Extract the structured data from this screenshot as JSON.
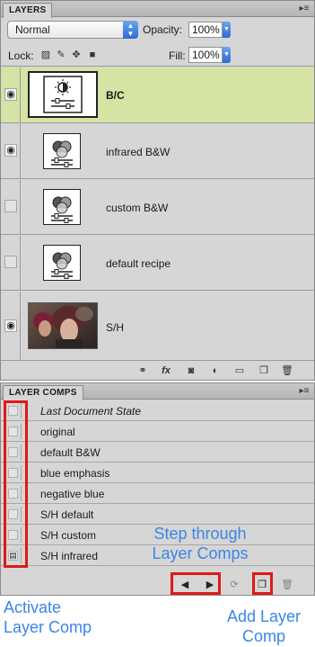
{
  "layers_panel": {
    "tab": "LAYERS",
    "menu_icon": "panel-menu-icon",
    "blend_mode": "Normal",
    "opacity_label": "Opacity:",
    "opacity_value": "100%",
    "lock_label": "Lock:",
    "fill_label": "Fill:",
    "fill_value": "100%",
    "layers": [
      {
        "name": "B/C",
        "visible": true,
        "selected": true,
        "thumb": "brightness-contrast-adjustment-icon"
      },
      {
        "name": "infrared B&W",
        "visible": true,
        "selected": false,
        "thumb": "black-white-adjustment-icon"
      },
      {
        "name": "custom B&W",
        "visible": false,
        "selected": false,
        "thumb": "black-white-adjustment-icon"
      },
      {
        "name": "default recipe",
        "visible": false,
        "selected": false,
        "thumb": "black-white-adjustment-icon"
      },
      {
        "name": "S/H",
        "visible": true,
        "selected": false,
        "thumb": "photo-thumbnail"
      }
    ],
    "footer_icons": [
      "link-icon",
      "fx-icon",
      "mask-icon",
      "adjustment-icon",
      "folder-icon",
      "new-layer-icon",
      "trash-icon"
    ]
  },
  "comps_panel": {
    "tab": "LAYER COMPS",
    "comps": [
      {
        "name": "Last Document State",
        "italic": true
      },
      {
        "name": "original",
        "italic": false
      },
      {
        "name": "default B&W",
        "italic": false
      },
      {
        "name": "blue emphasis",
        "italic": false
      },
      {
        "name": "negative blue",
        "italic": false
      },
      {
        "name": "S/H default",
        "italic": false
      },
      {
        "name": "S/H custom",
        "italic": false
      },
      {
        "name": "S/H infrared",
        "italic": false,
        "active": true
      }
    ],
    "footer_icons": [
      "previous-icon",
      "next-icon",
      "update-icon",
      "new-comp-icon",
      "trash-icon"
    ]
  },
  "annotations": {
    "step_line1": "Step through",
    "step_line2": "Layer Comps",
    "activate_line1": "Activate",
    "activate_line2": "Layer Comp",
    "add_line1": "Add Layer",
    "add_line2": "Comp"
  },
  "colors": {
    "selected_row": "#d5e3a4",
    "annotation": "#3a85e8",
    "highlight_box": "#e01818"
  }
}
